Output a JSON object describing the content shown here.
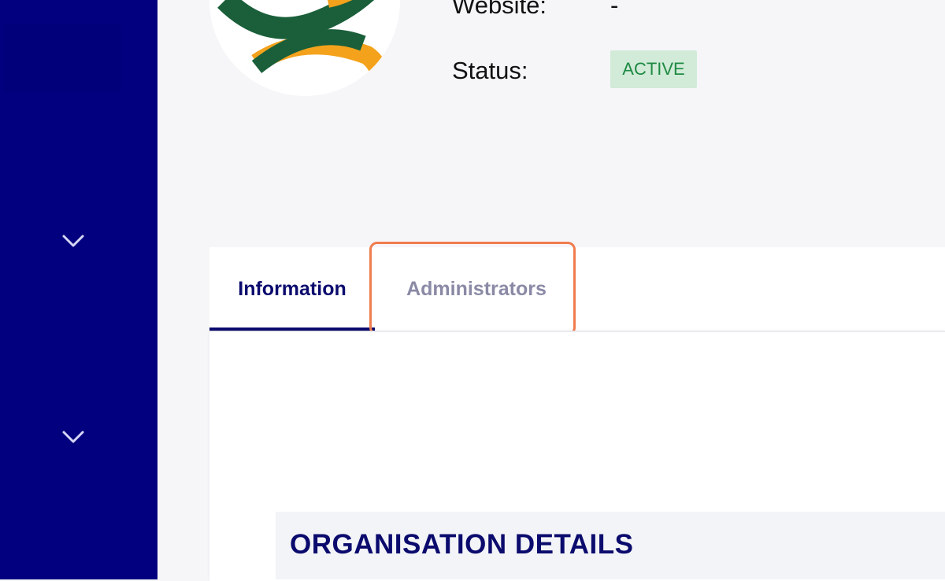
{
  "profile": {
    "website_label": "Website:",
    "website_value": "-",
    "status_label": "Status:",
    "status_badge": "ACTIVE"
  },
  "tabs": [
    {
      "label": "Information",
      "active": true
    },
    {
      "label": "Administrators",
      "active": false
    }
  ],
  "section": {
    "title": "ORGANISATION DETAILS"
  },
  "sidebar": {
    "icons": [
      "chevron-down-icon",
      "chevron-down-icon"
    ]
  },
  "colors": {
    "sidebar": "#02007f",
    "accent_navy": "#0b0b6e",
    "highlight": "#f07c4f",
    "badge_bg": "#d1ebd8",
    "badge_text": "#1f8a43"
  }
}
